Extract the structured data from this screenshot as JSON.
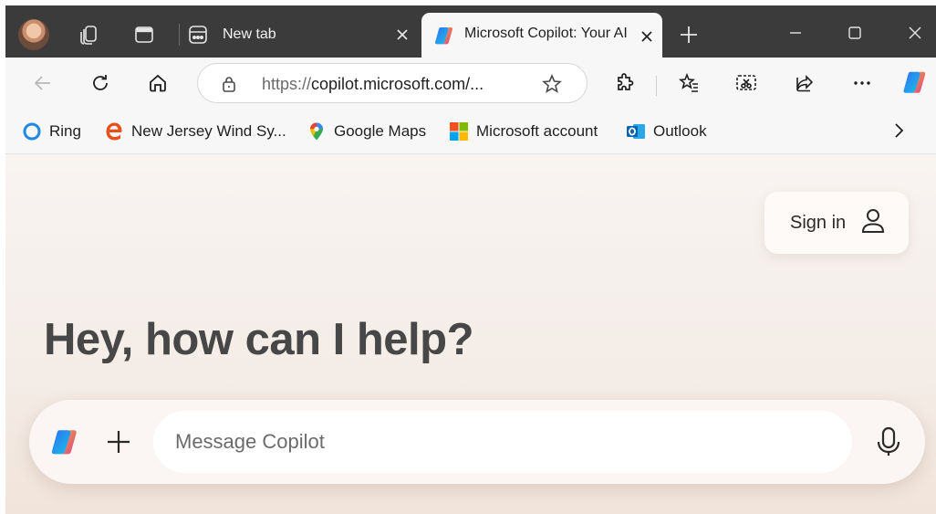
{
  "browser": {
    "tabs": [
      {
        "title": "New tab",
        "active": false
      },
      {
        "title": "Microsoft Copilot: Your AI companion",
        "active": true
      }
    ],
    "address_bar": {
      "protocol": "https://",
      "domain": "copilot.microsoft.com/..."
    },
    "favorites": [
      {
        "label": "Ring",
        "icon": "ring-icon"
      },
      {
        "label": "New Jersey Wind Sy...",
        "icon": "edge-e-icon"
      },
      {
        "label": "Google Maps",
        "icon": "google-maps-icon"
      },
      {
        "label": "Microsoft account",
        "icon": "microsoft-logo-icon"
      },
      {
        "label": "Outlook",
        "icon": "outlook-icon"
      }
    ]
  },
  "page": {
    "sign_in_label": "Sign in",
    "headline": "Hey, how can I help?",
    "composer": {
      "placeholder": "Message Copilot"
    }
  },
  "colors": {
    "tab_bar": "#3b3b3b",
    "toolbar": "#f7f7f7",
    "page_background": "#f6efea",
    "headline_text": "#474747"
  }
}
